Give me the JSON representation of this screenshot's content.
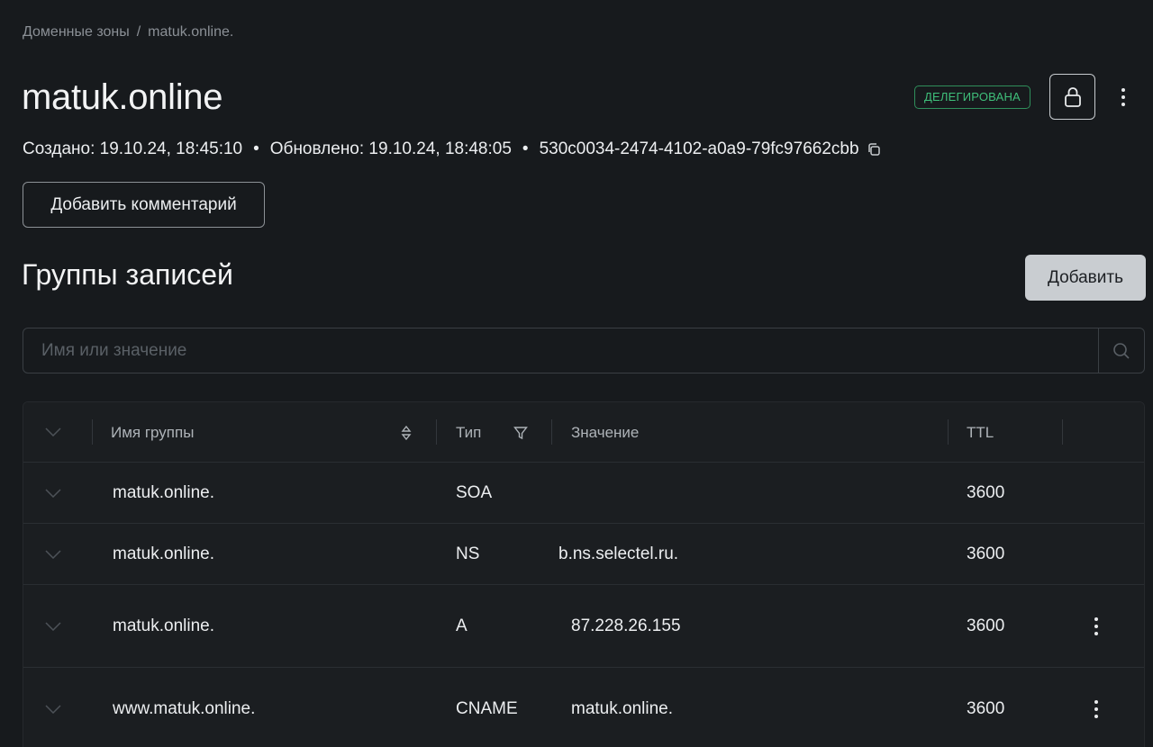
{
  "breadcrumb": {
    "root": "Доменные зоны",
    "separator": "/",
    "current": "matuk.online."
  },
  "zone": {
    "title": "matuk.online",
    "status": "ДЕЛЕГИРОВАНА",
    "created": "Создано: 19.10.24, 18:45:10",
    "updated": "Обновлено: 19.10.24, 18:48:05",
    "uuid": "530c0034-2474-4102-a0a9-79fc97662cbb",
    "bullet": "•",
    "comment_button": "Добавить комментарий"
  },
  "records": {
    "title": "Группы записей",
    "add_button": "Добавить",
    "search_placeholder": "Имя или значение",
    "columns": {
      "name": "Имя группы",
      "type": "Тип",
      "value": "Значение",
      "ttl": "TTL"
    },
    "rows": [
      {
        "name": "matuk.online.",
        "type": "SOA",
        "value": "",
        "ttl": "3600"
      },
      {
        "name": "matuk.online.",
        "type": "NS",
        "value": "b.ns.selectel.ru.",
        "ttl": "3600"
      },
      {
        "name": "matuk.online.",
        "type": "A",
        "value": "87.228.26.155",
        "ttl": "3600"
      },
      {
        "name": "www.matuk.online.",
        "type": "CNAME",
        "value": "matuk.online.",
        "ttl": "3600"
      }
    ]
  },
  "colors": {
    "background": "#171a1d",
    "status_green": "#3fbf7a",
    "primary_button": "#c9cdd1"
  }
}
